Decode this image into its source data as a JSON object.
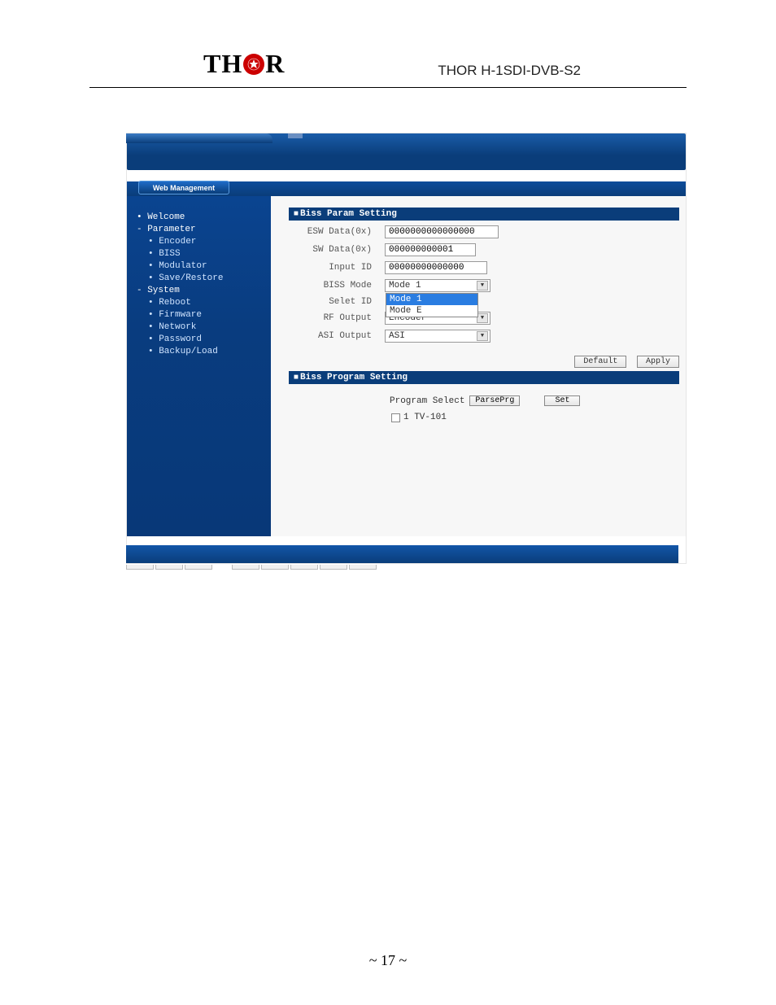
{
  "header": {
    "logo_left": "TH",
    "logo_right": "R",
    "title": "THOR H-1SDI-DVB-S2"
  },
  "tab": "Web Management",
  "sidebar": {
    "items": [
      {
        "label": "Welcome",
        "type": "top"
      },
      {
        "label": "Parameter",
        "type": "group"
      },
      {
        "label": "Encoder",
        "type": "sub"
      },
      {
        "label": "BISS",
        "type": "sub"
      },
      {
        "label": "Modulator",
        "type": "sub"
      },
      {
        "label": "Save/Restore",
        "type": "sub"
      },
      {
        "label": "System",
        "type": "group"
      },
      {
        "label": "Reboot",
        "type": "sub"
      },
      {
        "label": "Firmware",
        "type": "sub"
      },
      {
        "label": "Network",
        "type": "sub"
      },
      {
        "label": "Password",
        "type": "sub"
      },
      {
        "label": "Backup/Load",
        "type": "sub"
      }
    ]
  },
  "panels": {
    "param": {
      "title": "Biss Param Setting",
      "fields": {
        "esw": {
          "label": "ESW Data(0x)",
          "value": "0000000000000000"
        },
        "sw": {
          "label": "SW Data(0x)",
          "value": "000000000001"
        },
        "input_id": {
          "label": "Input ID",
          "value": "00000000000000"
        },
        "biss_mode": {
          "label": "BISS Mode",
          "value": "Mode 1",
          "options": [
            "Mode 1",
            "Mode E"
          ]
        },
        "selet_id": {
          "label": "Selet ID"
        },
        "rf_output": {
          "label": "RF Output",
          "value": "Encoder"
        },
        "asi_output": {
          "label": "ASI Output",
          "value": "ASI"
        }
      },
      "buttons": {
        "default": "Default",
        "apply": "Apply"
      }
    },
    "program": {
      "title": "Biss Program Setting",
      "select_label": "Program Select",
      "parse": "ParsePrg",
      "set": "Set",
      "item": "1 TV-101"
    }
  },
  "footer": {
    "page": "~ 17 ~"
  }
}
